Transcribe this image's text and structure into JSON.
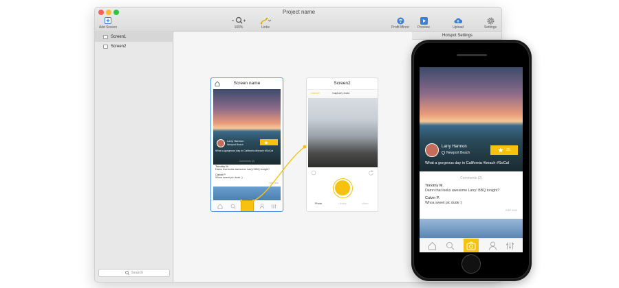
{
  "window": {
    "title": "Project name",
    "toolbar": {
      "add_screen": "Add Screen",
      "zoom": "100%",
      "links": "Links",
      "profit_mirror": "Profit Mirror",
      "preview": "Preview",
      "upload": "Upload",
      "settings": "Settings"
    },
    "sidebar": {
      "items": [
        {
          "label": "Screen1"
        },
        {
          "label": "Screen2"
        }
      ],
      "search_placeholder": "Search"
    }
  },
  "canvas": {
    "screen1": {
      "title": "Screen name",
      "user_name": "Larry Harmon",
      "location": "Newport Beach",
      "caption": "What a gorgeous day in California #beach #SoCal",
      "comments_label": "Comments (2)",
      "comments": [
        {
          "author": "Timothy M.",
          "text": "Damn that looks awesome Larry! BBQ tonight?"
        },
        {
          "author": "Calvin P.",
          "text": "Whoa sweet pic dude :)"
        }
      ],
      "add_new": "Add new"
    },
    "screen2": {
      "title": "Screen2",
      "cancel": "Cancel",
      "capture": "Capture photo",
      "tabs": [
        "Photo",
        "Library",
        "Video"
      ]
    }
  },
  "hotspot_settings": {
    "title": "Hotspot Settings"
  },
  "phone": {
    "user_name": "Larry Harmon",
    "location": "Newport Beach",
    "caption": "What a gorgeous day in California #beach #SoCal",
    "favorite_count": "25",
    "comments_label": "Comments (2)",
    "comments": [
      {
        "author": "Timothy M.",
        "text": "Damn that looks awesome Larry! BBQ tonight?"
      },
      {
        "author": "Calvin P.",
        "text": "Whoa sweet pic dude :)"
      }
    ],
    "add_new": "Add new"
  },
  "colors": {
    "accent": "#f6c10f",
    "selection": "#4a90e2",
    "link_line": "#f6c10f"
  }
}
